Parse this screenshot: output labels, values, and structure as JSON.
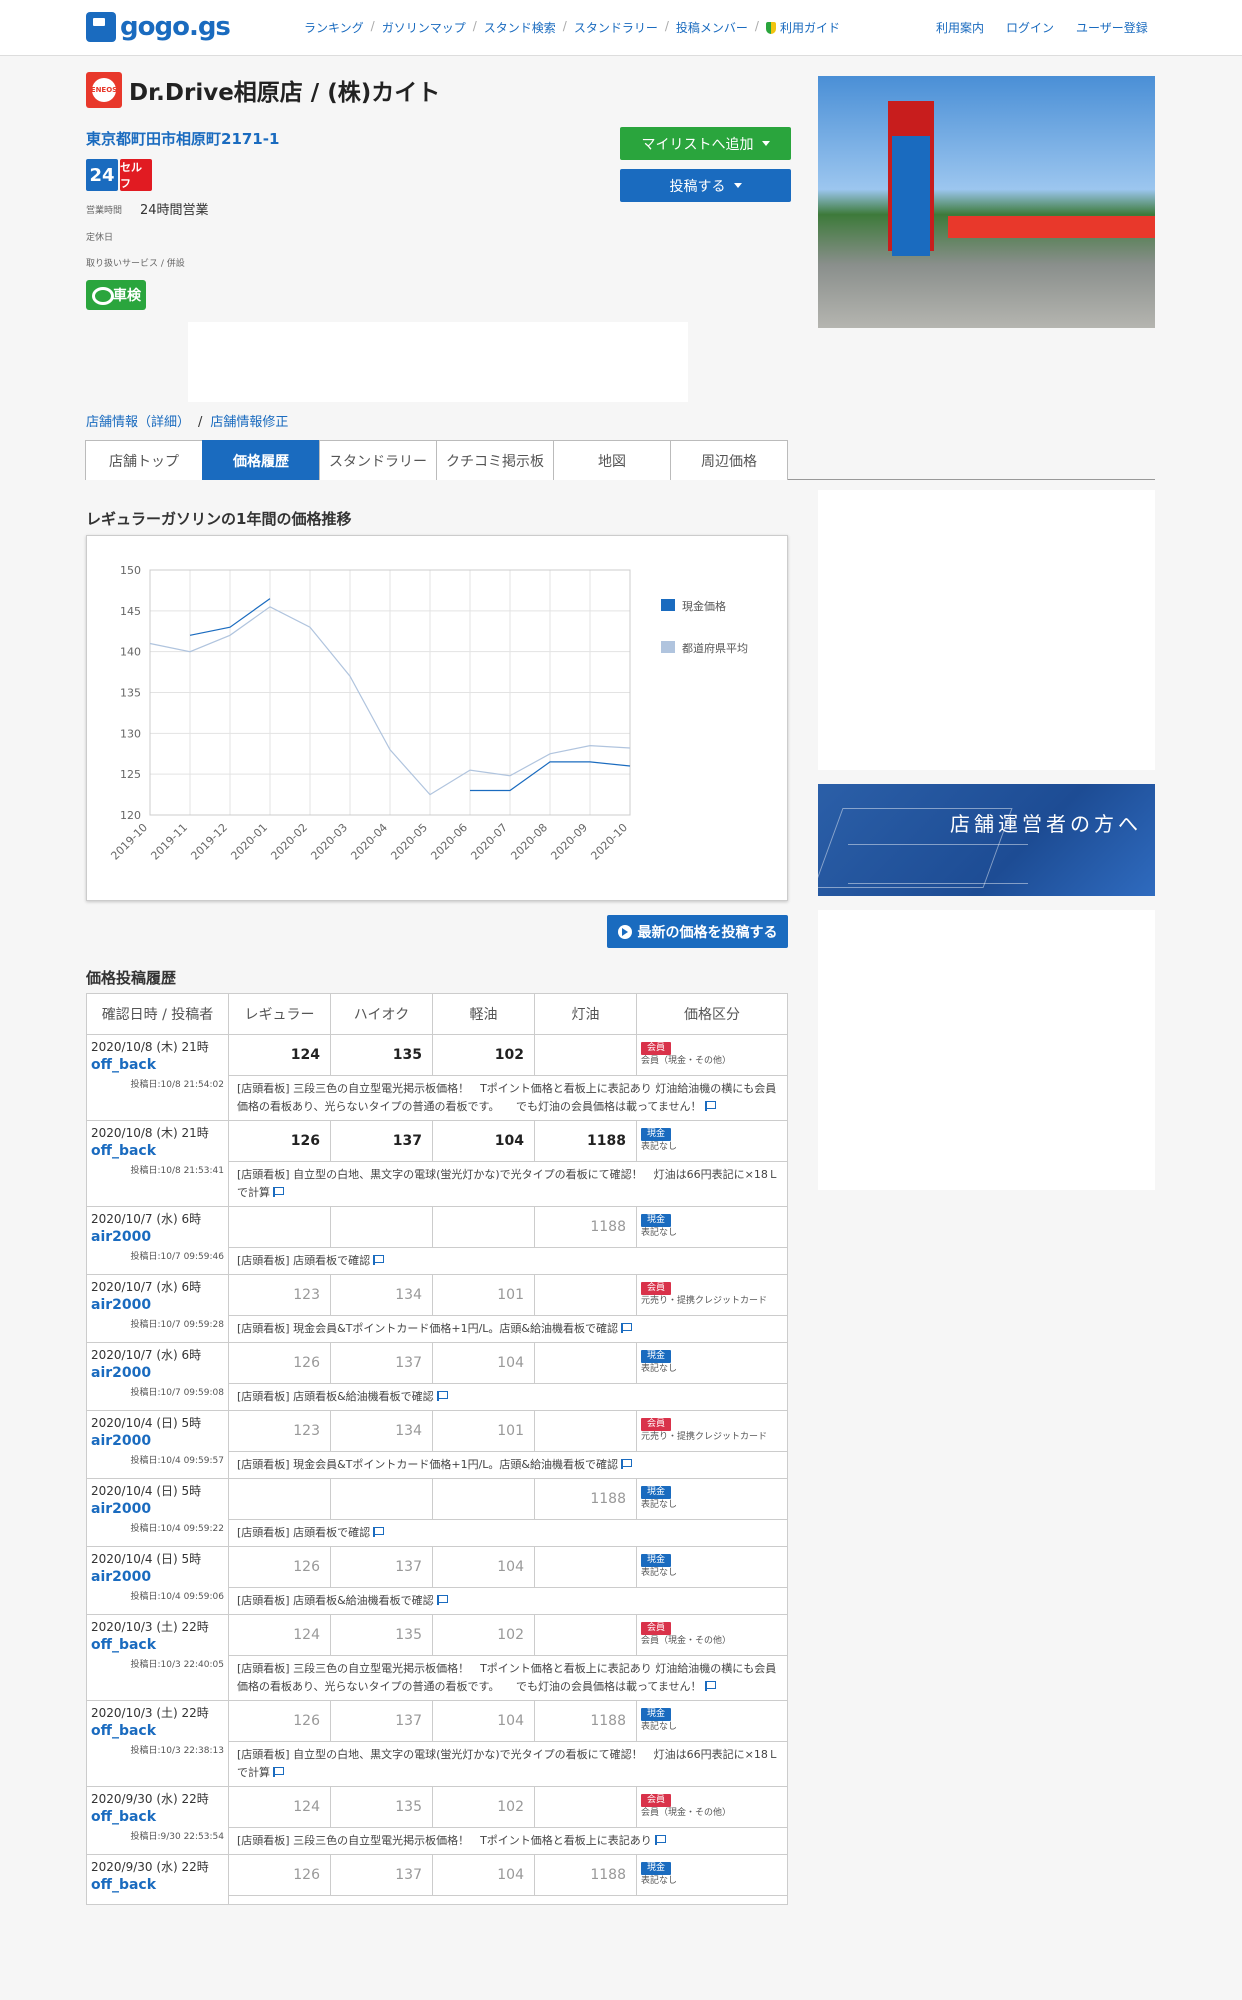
{
  "header": {
    "logo": "gogo.gs",
    "nav": [
      "ランキング",
      "ガソリンマップ",
      "スタンド検索",
      "スタンドラリー",
      "投稿メンバー",
      "利用ガイド"
    ],
    "right": [
      "利用案内",
      "ログイン",
      "ユーザー登録"
    ]
  },
  "shop": {
    "brand_logo": "ENEOS",
    "title": "Dr.Drive相原店 / (株)カイト",
    "address": "東京都町田市相原町2171-1",
    "badge_24": "24",
    "badge_self": "セルフ",
    "hours_label": "営業時間",
    "hours_value": "24時間営業",
    "holiday_label": "定休日",
    "service_label": "取り扱いサービス / 併設",
    "service_badge": "車検"
  },
  "buttons": {
    "mylist": "マイリストへ追加",
    "post": "投稿する",
    "latest": "最新の価格を投稿する"
  },
  "breadcrumb": [
    "店舗情報（詳細）",
    "店舗情報修正"
  ],
  "tabs": [
    "店舗トップ",
    "価格履歴",
    "スタンドラリー",
    "クチコミ掲示板",
    "地図",
    "周辺価格"
  ],
  "active_tab": 1,
  "chart_title": "レギュラーガソリンの1年間の価格推移",
  "chart_data": {
    "type": "line",
    "x": [
      "2019-10",
      "2019-11",
      "2019-12",
      "2020-01",
      "2020-02",
      "2020-03",
      "2020-04",
      "2020-05",
      "2020-06",
      "2020-07",
      "2020-08",
      "2020-09",
      "2020-10"
    ],
    "ylim": [
      120,
      150
    ],
    "yticks": [
      120,
      125,
      130,
      135,
      140,
      145,
      150
    ],
    "series": [
      {
        "name": "現金価格",
        "color": "#1a6bbf",
        "values": [
          null,
          142,
          143,
          146.5,
          null,
          null,
          null,
          null,
          123,
          123,
          126.5,
          126.5,
          126
        ]
      },
      {
        "name": "都道府県平均",
        "color": "#b0c4de",
        "values": [
          141,
          140,
          142,
          145.5,
          143,
          137,
          128,
          122.5,
          125.5,
          124.8,
          127.5,
          128.5,
          128.2
        ]
      }
    ],
    "legend_position": "right",
    "grid": true
  },
  "history_title": "価格投稿履歴",
  "history_headers": [
    "確認日時 / 投稿者",
    "レギュラー",
    "ハイオク",
    "軽油",
    "灯油",
    "価格区分"
  ],
  "history": [
    {
      "date": "2020/10/8 (木) 21時",
      "user": "off_back",
      "posted": "投稿日:10/8 21:54:02",
      "reg": "124",
      "hi": "135",
      "diesel": "102",
      "kero": "",
      "badge": "会員",
      "badge_type": "member",
      "kind": "会員（現金・その他）",
      "cur": true,
      "note": "[店頭看板] 三段三色の自立型電光掲示板価格！　Tポイント価格と看板上に表記あり 灯油給油機の横にも会員価格の看板あり、光らないタイプの普通の看板です。　　でも灯油の会員価格は載ってません！"
    },
    {
      "date": "2020/10/8 (木) 21時",
      "user": "off_back",
      "posted": "投稿日:10/8 21:53:41",
      "reg": "126",
      "hi": "137",
      "diesel": "104",
      "kero": "1188",
      "badge": "現金",
      "badge_type": "cash",
      "kind": "表記なし",
      "cur": true,
      "note": "[店頭看板] 自立型の白地、黒文字の電球(蛍光灯かな)で光タイプの看板にて確認！　灯油は66円表記に×18Ｌで計算"
    },
    {
      "date": "2020/10/7 (水) 6時",
      "user": "air2000",
      "posted": "投稿日:10/7 09:59:46",
      "reg": "",
      "hi": "",
      "diesel": "",
      "kero": "1188",
      "badge": "現金",
      "badge_type": "cash",
      "kind": "表記なし",
      "cur": false,
      "note": "[店頭看板] 店頭看板で確認"
    },
    {
      "date": "2020/10/7 (水) 6時",
      "user": "air2000",
      "posted": "投稿日:10/7 09:59:28",
      "reg": "123",
      "hi": "134",
      "diesel": "101",
      "kero": "",
      "badge": "会員",
      "badge_type": "member",
      "kind": "元売り・提携クレジットカード",
      "cur": false,
      "note": "[店頭看板] 現金会員&Tポイントカード価格+1円/L。店頭&給油機看板で確認"
    },
    {
      "date": "2020/10/7 (水) 6時",
      "user": "air2000",
      "posted": "投稿日:10/7 09:59:08",
      "reg": "126",
      "hi": "137",
      "diesel": "104",
      "kero": "",
      "badge": "現金",
      "badge_type": "cash",
      "kind": "表記なし",
      "cur": false,
      "note": "[店頭看板] 店頭看板&給油機看板で確認"
    },
    {
      "date": "2020/10/4 (日) 5時",
      "user": "air2000",
      "posted": "投稿日:10/4 09:59:57",
      "reg": "123",
      "hi": "134",
      "diesel": "101",
      "kero": "",
      "badge": "会員",
      "badge_type": "member",
      "kind": "元売り・提携クレジットカード",
      "cur": false,
      "note": "[店頭看板] 現金会員&Tポイントカード価格+1円/L。店頭&給油機看板で確認"
    },
    {
      "date": "2020/10/4 (日) 5時",
      "user": "air2000",
      "posted": "投稿日:10/4 09:59:22",
      "reg": "",
      "hi": "",
      "diesel": "",
      "kero": "1188",
      "badge": "現金",
      "badge_type": "cash",
      "kind": "表記なし",
      "cur": false,
      "note": "[店頭看板] 店頭看板で確認"
    },
    {
      "date": "2020/10/4 (日) 5時",
      "user": "air2000",
      "posted": "投稿日:10/4 09:59:06",
      "reg": "126",
      "hi": "137",
      "diesel": "104",
      "kero": "",
      "badge": "現金",
      "badge_type": "cash",
      "kind": "表記なし",
      "cur": false,
      "note": "[店頭看板] 店頭看板&給油機看板で確認"
    },
    {
      "date": "2020/10/3 (土) 22時",
      "user": "off_back",
      "posted": "投稿日:10/3 22:40:05",
      "reg": "124",
      "hi": "135",
      "diesel": "102",
      "kero": "",
      "badge": "会員",
      "badge_type": "member",
      "kind": "会員（現金・その他）",
      "cur": false,
      "note": "[店頭看板] 三段三色の自立型電光掲示板価格！　Tポイント価格と看板上に表記あり 灯油給油機の横にも会員価格の看板あり、光らないタイプの普通の看板です。　　でも灯油の会員価格は載ってません！"
    },
    {
      "date": "2020/10/3 (土) 22時",
      "user": "off_back",
      "posted": "投稿日:10/3 22:38:13",
      "reg": "126",
      "hi": "137",
      "diesel": "104",
      "kero": "1188",
      "badge": "現金",
      "badge_type": "cash",
      "kind": "表記なし",
      "cur": false,
      "note": "[店頭看板] 自立型の白地、黒文字の電球(蛍光灯かな)で光タイプの看板にて確認！　灯油は66円表記に×18Ｌで計算"
    },
    {
      "date": "2020/9/30 (水) 22時",
      "user": "off_back",
      "posted": "投稿日:9/30 22:53:54",
      "reg": "124",
      "hi": "135",
      "diesel": "102",
      "kero": "",
      "badge": "会員",
      "badge_type": "member",
      "kind": "会員（現金・その他）",
      "cur": false,
      "note": "[店頭看板] 三段三色の自立型電光掲示板価格！　Tポイント価格と看板上に表記あり"
    },
    {
      "date": "2020/9/30 (水) 22時",
      "user": "off_back",
      "posted": "",
      "reg": "126",
      "hi": "137",
      "diesel": "104",
      "kero": "1188",
      "badge": "現金",
      "badge_type": "cash",
      "kind": "表記なし",
      "cur": false,
      "note": ""
    }
  ],
  "banner_text": "店舗運営者の方へ"
}
